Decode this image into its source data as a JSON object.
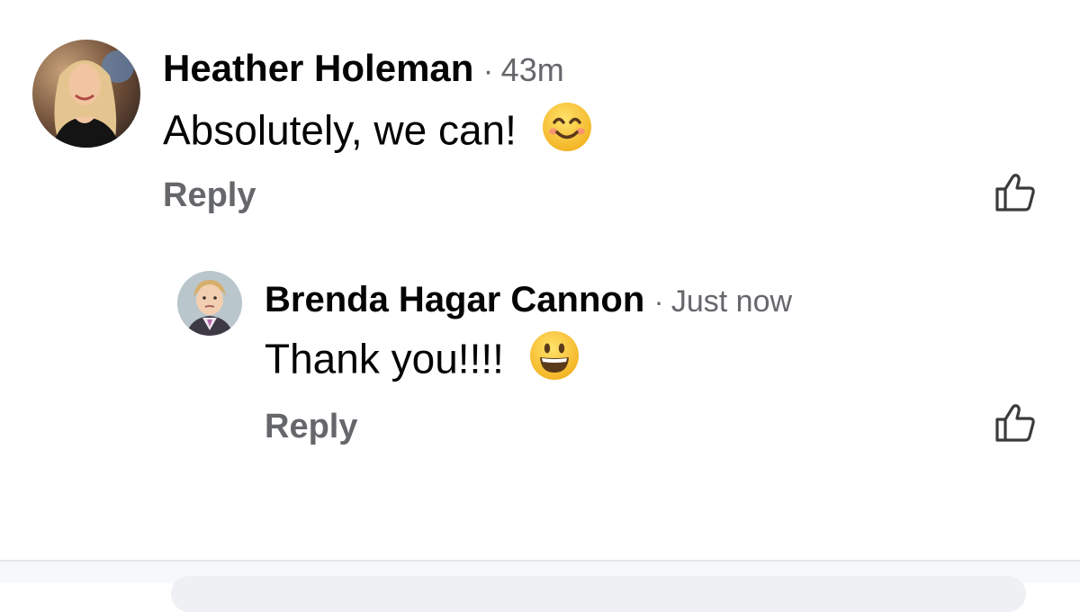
{
  "comments": [
    {
      "author": "Heather Holeman",
      "separator": "·",
      "time": "43m",
      "text": "Absolutely, we can!",
      "emoji": "smiling-face-with-smiling-eyes-icon",
      "reply_label": "Reply"
    },
    {
      "author": "Brenda Hagar Cannon",
      "separator": "·",
      "time": "Just now",
      "text": "Thank you!!!!",
      "emoji": "grinning-face-icon",
      "reply_label": "Reply"
    }
  ],
  "colors": {
    "name": "#050505",
    "meta": "#65676b",
    "emoji_yellow": "#f9c93c"
  }
}
